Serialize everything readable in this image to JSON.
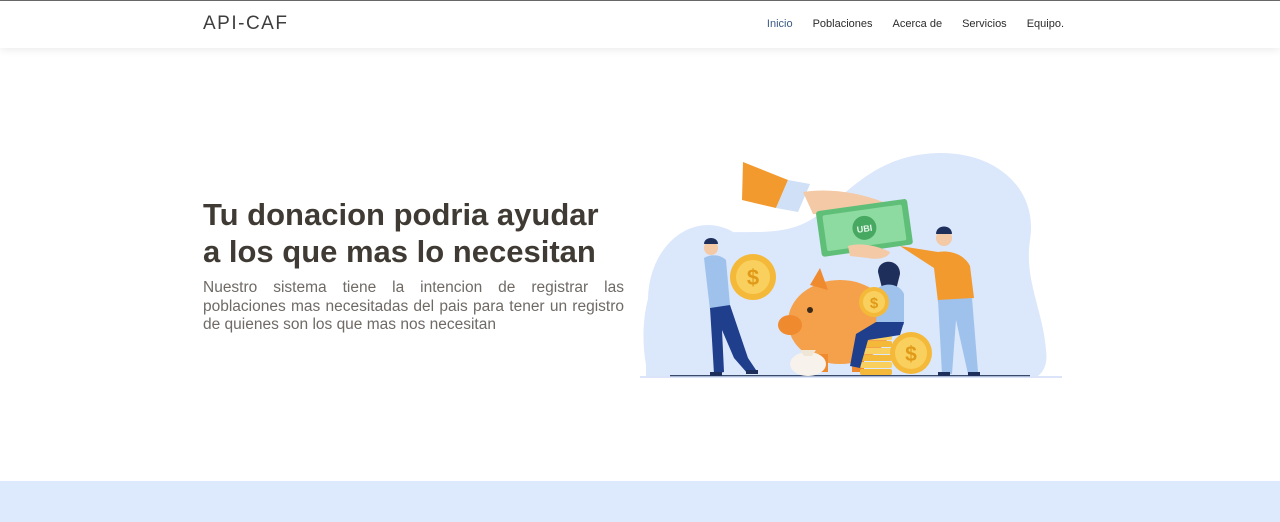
{
  "nav": {
    "brand": "API-CAF",
    "links": [
      "Inicio",
      "Poblaciones",
      "Acerca de",
      "Servicios",
      "Equipo."
    ]
  },
  "hero": {
    "title_line1": "Tu donacion podria ayudar",
    "title_line2": "a los que mas lo necesitan",
    "description": "Nuestro sistema tiene la intencion de registrar las poblaciones mas necesitadas del pais para tener un registro de quienes son los que mas nos necesitan",
    "bill_label": "UBI"
  },
  "colors": {
    "accent_nav": "#3a5a86",
    "title_text": "#3f3a33",
    "body_text": "#6f6a66",
    "footer_band": "#dde9fc",
    "illustration_blob": "#dbe7fb",
    "coin": "#f5b93a",
    "bill": "#7ed08f",
    "piggy": "#f5a04a"
  }
}
